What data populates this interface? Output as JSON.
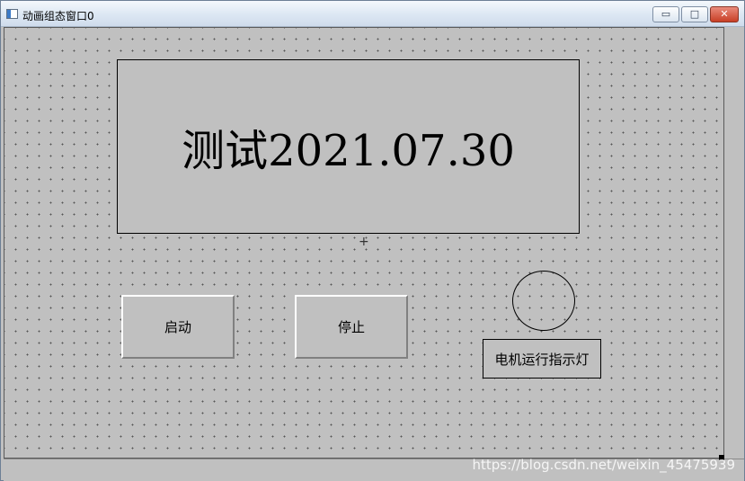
{
  "window": {
    "title": "动画组态窗口0",
    "controls": {
      "minimize": "▭",
      "maximize": "□",
      "close": "✕"
    }
  },
  "display": {
    "text": "测试2021.07.30"
  },
  "buttons": {
    "start_label": "启动",
    "stop_label": "停止"
  },
  "indicator": {
    "label": "电机运行指示灯"
  },
  "cursor": {
    "glyph": "+"
  },
  "watermark": {
    "text": "https://blog.csdn.net/weixin_45475939"
  }
}
